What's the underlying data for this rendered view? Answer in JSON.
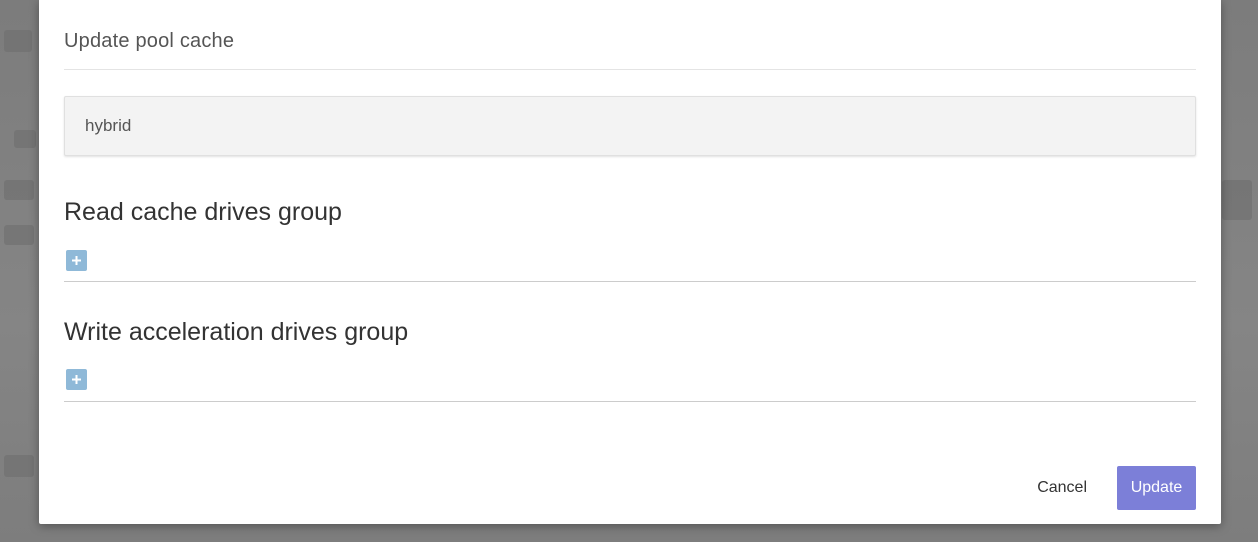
{
  "dialog": {
    "title": "Update pool cache",
    "pool_name": "hybrid",
    "sections": [
      {
        "title": "Read cache drives group",
        "add_icon": "plus-square-icon"
      },
      {
        "title": "Write acceleration drives group",
        "add_icon": "plus-square-icon"
      }
    ],
    "footer": {
      "cancel_label": "Cancel",
      "update_label": "Update"
    }
  },
  "colors": {
    "accent": "#7c7fd8",
    "add_button": "#8fb9d8",
    "overlay": "#808080"
  }
}
